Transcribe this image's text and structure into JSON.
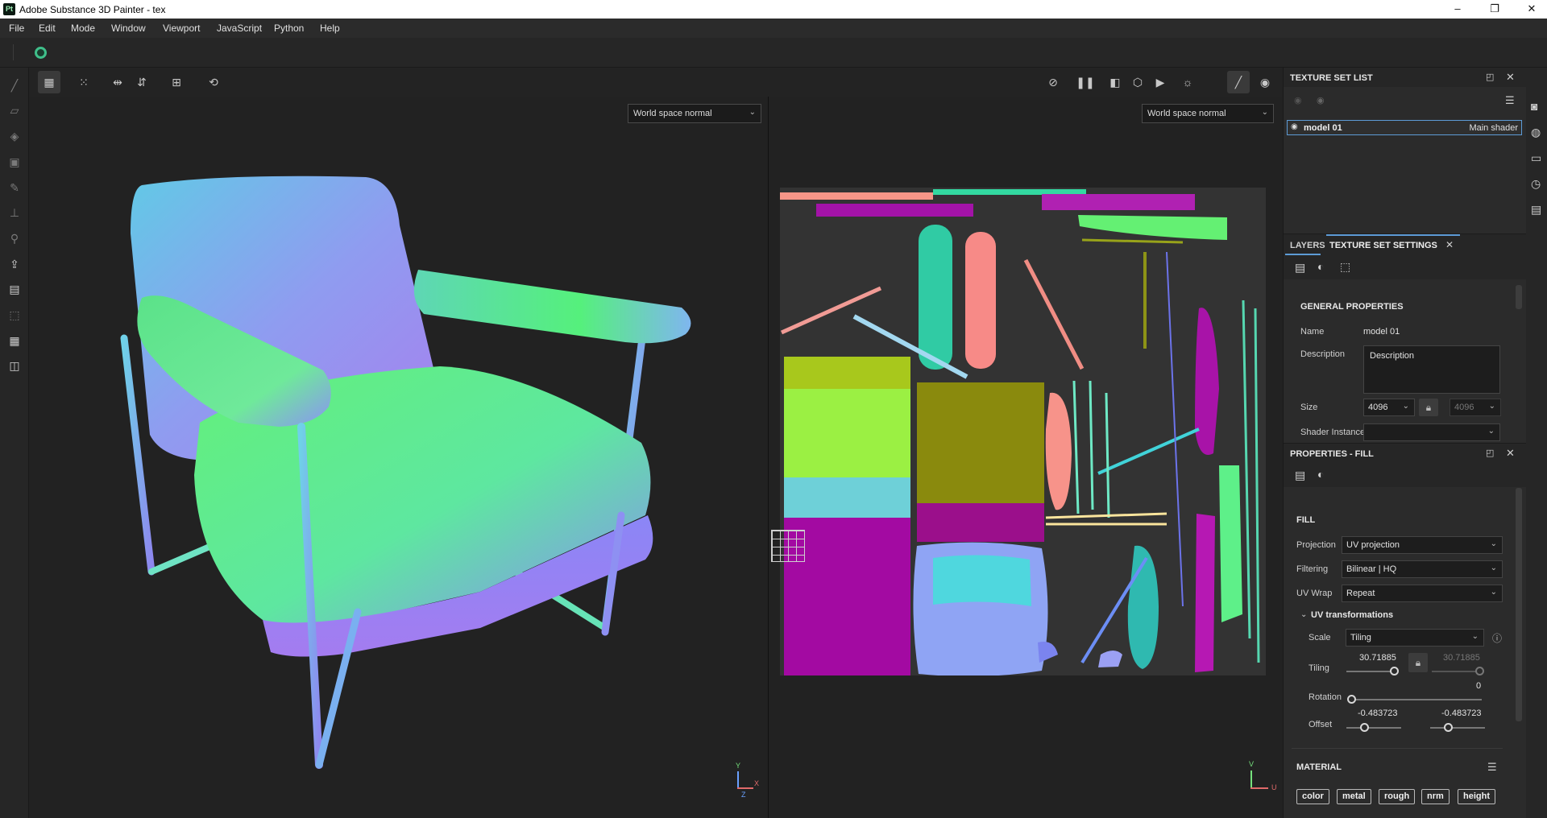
{
  "window": {
    "icon_text": "Pt",
    "title": "Adobe Substance 3D Painter - tex",
    "controls": [
      "–",
      "❐",
      "✕"
    ]
  },
  "menu": [
    "File",
    "Edit",
    "Mode",
    "Window",
    "Viewport",
    "JavaScript",
    "Python",
    "Help"
  ],
  "viewport_3d": {
    "channel_select": "World space normal"
  },
  "viewport_2d": {
    "channel_select": "World space normal"
  },
  "texture_set_list": {
    "title": "TEXTURE SET LIST",
    "items": [
      {
        "name": "model 01",
        "shader": "Main shader"
      }
    ]
  },
  "tabs": {
    "layers": "LAYERS",
    "texture_set_settings": "TEXTURE SET SETTINGS"
  },
  "general_properties": {
    "title": "GENERAL PROPERTIES",
    "name_label": "Name",
    "name_value": "model 01",
    "description_label": "Description",
    "description_value": "Description",
    "size_label": "Size",
    "size_value": "4096",
    "size_value_2": "4096",
    "shader_instance_label": "Shader Instance"
  },
  "properties_fill": {
    "title": "PROPERTIES - FILL",
    "fill_title": "FILL",
    "projection_label": "Projection",
    "projection_value": "UV projection",
    "filtering_label": "Filtering",
    "filtering_value": "Bilinear | HQ",
    "uvwrap_label": "UV Wrap",
    "uvwrap_value": "Repeat",
    "uv_transform_title": "UV transformations",
    "scale_label": "Scale",
    "scale_value": "Tiling",
    "tiling_label": "Tiling",
    "tiling_value": "30.71885",
    "tiling_value_2": "30.71885",
    "tiling_fraction": 0.8,
    "rotation_label": "Rotation",
    "rotation_value": "0",
    "offset_label": "Offset",
    "offset_u": "-0.483723",
    "offset_v": "-0.483723",
    "material_title": "MATERIAL",
    "channels": [
      "color",
      "metal",
      "rough",
      "nrm",
      "height"
    ]
  },
  "axis_labels": {
    "x": "X",
    "z": "Z",
    "y": "Y",
    "v": "V",
    "u": "U"
  },
  "icons": {
    "left_tools": [
      "paint-brush-icon",
      "eraser-icon",
      "projection-icon",
      "polygon-fill-icon",
      "smudge-icon",
      "clone-stamp-icon",
      "color-picker-icon",
      "export-icon",
      "bake-icon",
      "geometry-mask-icon",
      "report-icon",
      "stack-icon"
    ],
    "right_strip": [
      "display-settings-icon",
      "environment-icon",
      "shelf-icon",
      "history-icon",
      "log-icon"
    ]
  }
}
